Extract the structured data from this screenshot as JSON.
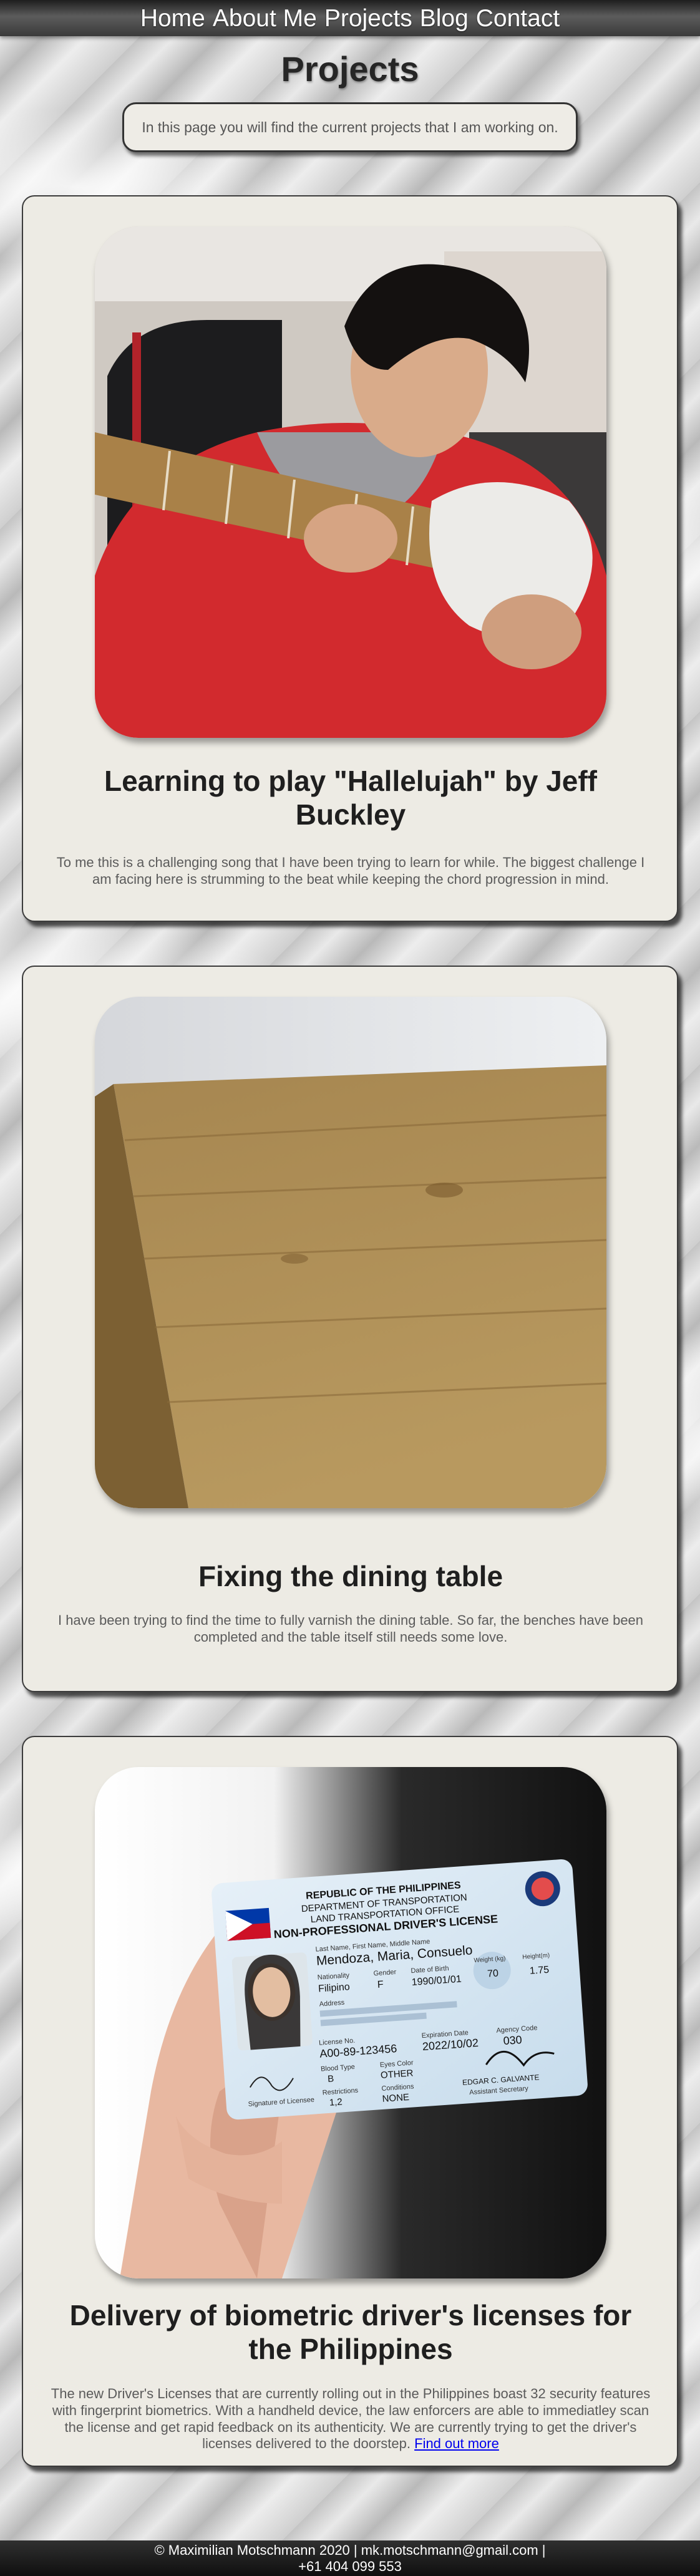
{
  "nav": {
    "items": [
      "Home",
      "About Me",
      "Projects",
      "Blog",
      "Contact"
    ]
  },
  "header": {
    "title": "Projects",
    "intro": "In this page you will find the current projects that I am working on."
  },
  "projects": [
    {
      "title": "Learning to play \"Hallelujah\" by Jeff Buckley",
      "description": "To me this is a challenging song that I have been trying to learn for while. The biggest challenge I am facing here is strumming to the beat while keeping the chord progression in mind.",
      "image_icon": "guitar-player-photo"
    },
    {
      "title": "Fixing the dining table",
      "description": "I have been trying to find the time to fully varnish the dining table. So far, the benches have been completed and the table itself still needs some love.",
      "image_icon": "wooden-table-photo"
    },
    {
      "title": "Delivery of biometric driver's licenses for the Philippines",
      "description": "The new Driver's Licenses that are currently rolling out in the Philippines boast 32 security features with fingerprint biometrics. With a handheld device, the law enforcers are able to immediatley scan the license and get rapid feedback on its authenticity. We are currently trying to get the driver's licenses delivered to the doorstep.",
      "link_text": "Find out more",
      "image_icon": "drivers-license-photo"
    }
  ],
  "license_card": {
    "line1": "REPUBLIC OF THE PHILIPPINES",
    "line2": "DEPARTMENT OF TRANSPORTATION",
    "line3": "LAND TRANSPORTATION OFFICE",
    "line4": "NON-PROFESSIONAL DRIVER'S LICENSE",
    "name_label": "Last Name, First Name, Middle Name",
    "name": "Mendoza, Maria, Consuelo",
    "nationality_label": "Nationality",
    "nationality": "Filipino",
    "sex_label": "Gender",
    "sex": "F",
    "dob_label": "Date of Birth",
    "dob": "1990/01/01",
    "weight_label": "Weight (kg)",
    "weight": "70",
    "height_label": "Height(m)",
    "height": "1.75",
    "address_label": "Address",
    "license_no_label": "License No.",
    "license_no": "A00-89-123456",
    "expiration_label": "Expiration Date",
    "expiration": "2022/10/02",
    "agency_label": "Agency Code",
    "agency": "030",
    "blood_label": "Blood Type",
    "blood": "B",
    "eyes_label": "Eyes Color",
    "eyes": "OTHER",
    "restrictions_label": "Restrictions",
    "restrictions": "1,2",
    "conditions_label": "Conditions",
    "conditions": "NONE",
    "signature_label": "Signature of Licensee",
    "official_name": "EDGAR C. GALVANTE",
    "official_title": "Assistant Secretary"
  },
  "footer": {
    "line1": "© Maximilian Motschmann 2020 | mk.motschmann@gmail.com |",
    "line2": "+61 404 099 553"
  },
  "colors": {
    "card_background": "#edebe4",
    "nav_background": "#3a3a3a",
    "link": "#0000ee"
  }
}
